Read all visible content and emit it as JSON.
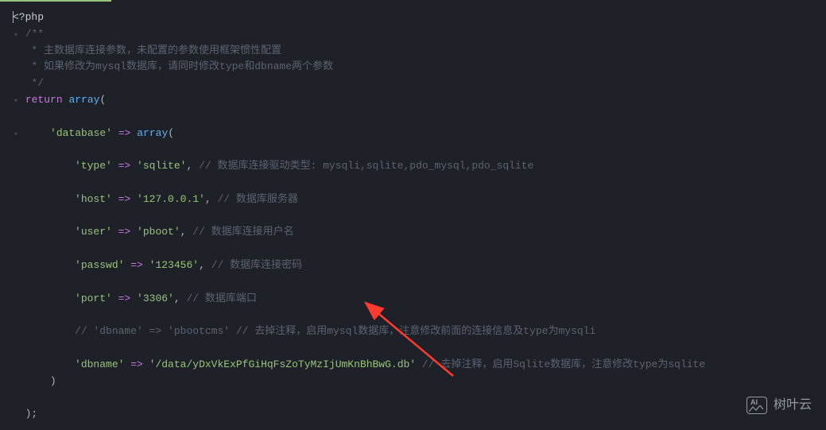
{
  "code": {
    "open_tag": "<?php",
    "comment_open": "/**",
    "comment_line1": " * 主数据库连接参数，未配置的参数使用框架惯性配置",
    "comment_line2": " * 如果修改为mysql数据库，请同时修改type和dbname两个参数",
    "comment_close": " */",
    "return_kw": "return",
    "array_fn": "array",
    "paren_open": "(",
    "paren_close": ")",
    "key_database": "'database'",
    "arrow_op": " => ",
    "key_type": "'type'",
    "val_type": "'sqlite'",
    "comma": ",",
    "comment_type": " // 数据库连接驱动类型: mysqli,sqlite,pdo_mysql,pdo_sqlite",
    "key_host": "'host'",
    "val_host": "'127.0.0.1'",
    "comment_host": " // 数据库服务器",
    "key_user": "'user'",
    "val_user": "'pboot'",
    "comment_user": " // 数据库连接用户名",
    "key_passwd": "'passwd'",
    "val_passwd": "'123456'",
    "comment_passwd": " // 数据库连接密码",
    "key_port": "'port'",
    "val_port": "'3306'",
    "comment_port": " // 数据库端口",
    "commented_dbname": "// 'dbname' => 'pbootcms' // 去掉注释，启用mysql数据库，注意修改前面的连接信息及type为mysqli",
    "key_dbname": "'dbname'",
    "val_dbname": "'/data/yDxVkExPfGiHqFsZoTyMzIjUmKnBhBwG.db'",
    "comment_dbname": " // 去掉注释，启用Sqlite数据库，注意修改type为sqlite",
    "close_inner": ")",
    "close_outer": ");"
  },
  "watermark": {
    "label": "AI",
    "text": "树叶云"
  }
}
